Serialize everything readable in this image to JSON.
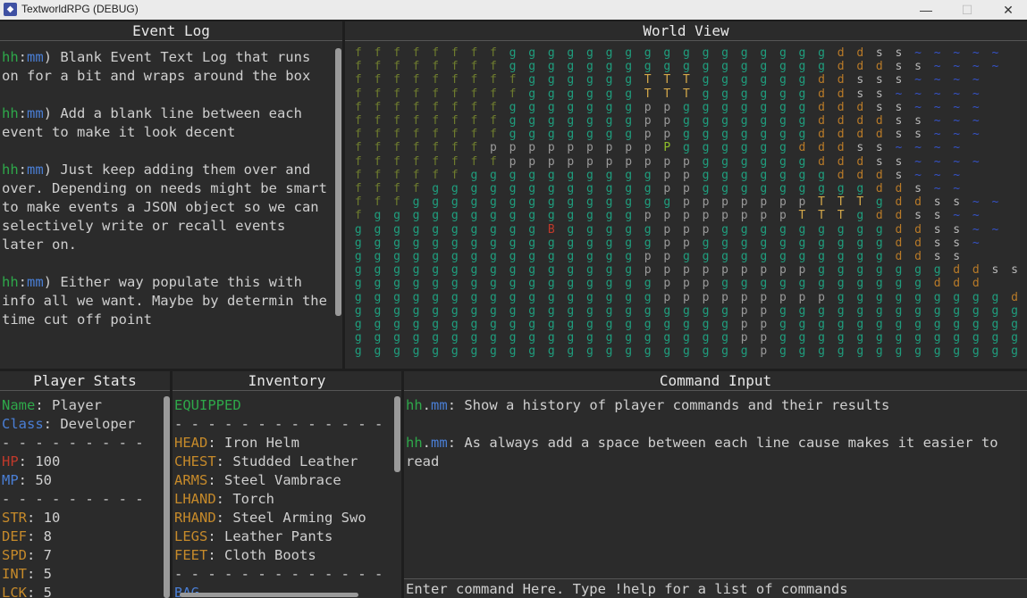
{
  "window": {
    "title": "TextworldRPG (DEBUG)",
    "min": "—",
    "max": "☐",
    "close": "✕"
  },
  "event_log": {
    "title": "Event Log",
    "entries": [
      {
        "actor": "hh",
        "target": "mm",
        "text": ") Blank Event Text Log that runs on for a bit and wraps around the box"
      },
      {
        "actor": "hh",
        "target": "mm",
        "text": ") Add a blank line between each event to make it look decent"
      },
      {
        "actor": "hh",
        "target": "mm",
        "text": ") Just keep adding them over and over. Depending on needs might be smart to make events a JSON object so we can selectively write or recall events later on."
      },
      {
        "actor": "hh",
        "target": "mm",
        "text": ") Either way populate this with info all we want. Maybe by determin the time cut off point"
      }
    ]
  },
  "world_view": {
    "title": "World View",
    "rows": [
      "ffffffffgggggggggggggggggddss~~~~~",
      "ffffffffgggggggggggggggggdddss~~~~",
      "fffffffffggggggTTTggggggddsss~~~~",
      "fffffffffggggggTTTggggggddss~~~~~",
      "ffffffffgggggggppgggggggdddss~~~~",
      "ffffffffgggggggppgggggggddddss~~~",
      "ffffffffgggggggppgggggggddddss~~~",
      "fffffffpppppppppPggggggdddss~~~~",
      "ffffffffppppppppppggggggdddss~~~~",
      "ffffffggggggggggppgggggggddds~~~",
      "ffffggggggggggggppgggggggggdds~~",
      "fffggggggggggggggpppppppTTTgddss~~",
      "fggggggggggggggppppppppTTTgddss~~",
      "ggggggggggBgggggpppgggggggggddss~~",
      "ggggggggggggggggppggggggggggddss~",
      "gggggggggggggggppgggggggggggddss",
      "gggggggggggggggpppppppppgggggggddss",
      "ggggggggggggggggpppgggggggggggddd",
      "ggggggggggggggggpppppppppgggggggggdd",
      "ggggggggggggggggggggppgggggggggggggg",
      "ggggggggggggggggggggppgggggggggggggg",
      "ggggggggggggggggggggppgggggggggggggg",
      "gggggggggggggggggggggpgggggggggggggg"
    ]
  },
  "player_stats": {
    "title": "Player Stats",
    "name_label": "Name",
    "name": "Player",
    "class_label": "Class",
    "class": "Developer",
    "divider": "- - - - - - - - -",
    "hp_label": "HP",
    "hp": "100",
    "mp_label": "MP",
    "mp": "50",
    "stats": [
      {
        "k": "STR",
        "v": "10"
      },
      {
        "k": "DEF",
        "v": "8"
      },
      {
        "k": "SPD",
        "v": "7"
      },
      {
        "k": "INT",
        "v": "5"
      },
      {
        "k": "LCK",
        "v": "5"
      }
    ]
  },
  "inventory": {
    "title": "Inventory",
    "equipped_label": "EQUIPPED",
    "divider": "- - - - - - - - - - - - -",
    "slots": [
      {
        "k": "HEAD",
        "v": "Iron Helm"
      },
      {
        "k": "CHEST",
        "v": "Studded Leather"
      },
      {
        "k": "ARMS",
        "v": "Steel Vambrace"
      },
      {
        "k": "LHAND",
        "v": "Torch"
      },
      {
        "k": "RHAND",
        "v": "Steel Arming Swo"
      },
      {
        "k": "LEGS",
        "v": "Leather Pants"
      },
      {
        "k": "FEET",
        "v": "Cloth Boots"
      }
    ],
    "bag_label": "BAG"
  },
  "command": {
    "title": "Command Input",
    "history": [
      {
        "actor": "hh",
        "target": "mm",
        "text": ": Show a history of player commands and their results"
      },
      {
        "actor": "hh",
        "target": "mm",
        "text": ": As always add a space between each line cause makes it easier to read"
      }
    ],
    "placeholder": "Enter command Here. Type !help for a list of commands"
  },
  "colors": {
    "f": "#6f7d2e",
    "g": "#1f9e7e",
    "T": "#d4a84a",
    "p": "#9a9a9a",
    "P": "#8fbf2a",
    "d": "#b87a28",
    "s": "#b9b9b9",
    "~": "#3552c8",
    "B": "#c0392b",
    "actor": "#2ea84a",
    "target": "#4a7fd6",
    "label_gold": "#c68a2a",
    "hp": "#c0392b",
    "mp": "#4a7fd6"
  }
}
